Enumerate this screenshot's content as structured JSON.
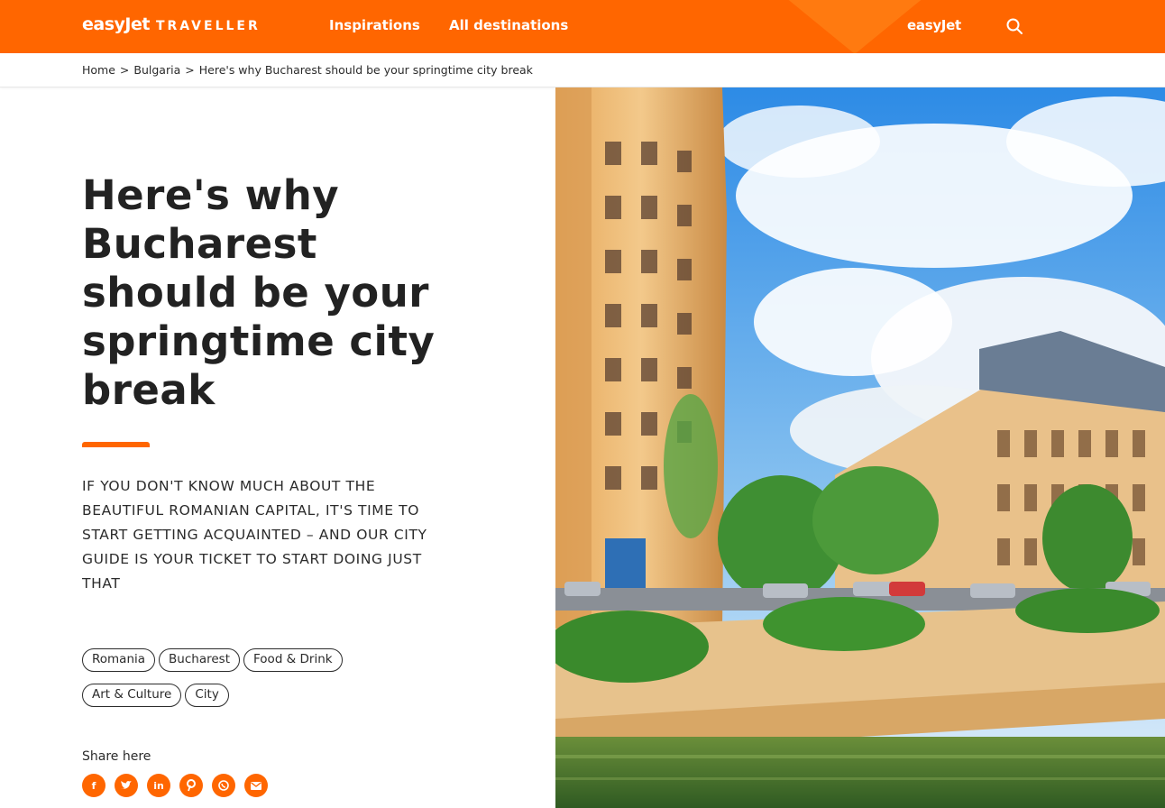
{
  "header": {
    "logo_main": "easyJet",
    "logo_sub": "TRAVELLER",
    "nav": [
      "Inspirations",
      "All destinations"
    ],
    "brand": "easyJet",
    "search_icon": "search-icon"
  },
  "breadcrumb": {
    "items": [
      "Home",
      "Bulgaria",
      "Here's why Bucharest should be your springtime city break"
    ],
    "separator": ">"
  },
  "article": {
    "title": "Here's why Bucharest should be your springtime city break",
    "standfirst": "IF YOU DON'T KNOW MUCH ABOUT THE BEAUTIFUL ROMANIAN CAPITAL, IT'S TIME TO START GETTING ACQUAINTED – AND OUR CITY GUIDE IS YOUR TICKET TO START DOING JUST THAT",
    "tags": [
      "Romania",
      "Bucharest",
      "Food & Drink",
      "Art & Culture",
      "City"
    ]
  },
  "share": {
    "label": "Share here",
    "icons": [
      "facebook-icon",
      "twitter-icon",
      "linkedin-icon",
      "pinterest-icon",
      "whatsapp-icon",
      "email-icon"
    ]
  },
  "colors": {
    "brand_orange": "#ff6600",
    "text": "#2b2b2b"
  }
}
